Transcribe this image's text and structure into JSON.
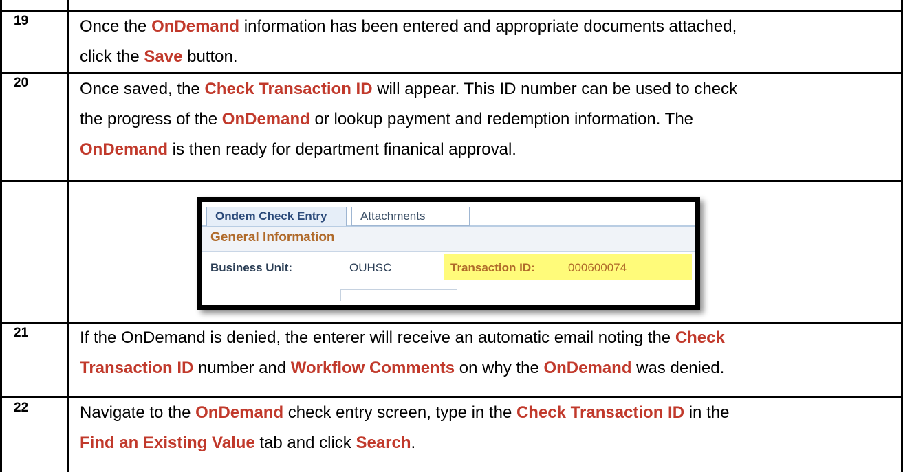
{
  "steps": [
    {
      "number": "19",
      "lines": [
        [
          {
            "t": "Once the ",
            "b": false
          },
          {
            "t": "OnDemand",
            "b": true
          },
          {
            "t": " information has been entered and appropriate documents attached,",
            "b": false
          }
        ],
        [
          {
            "t": "click the ",
            "b": false
          },
          {
            "t": "Save",
            "b": true
          },
          {
            "t": " button.",
            "b": false
          }
        ]
      ]
    },
    {
      "number": "20",
      "lines": [
        [
          {
            "t": "Once saved, the ",
            "b": false
          },
          {
            "t": "Check Transaction ID",
            "b": true
          },
          {
            "t": " will appear.  This ID number can be used to check",
            "b": false
          }
        ],
        [
          {
            "t": "the progress of the ",
            "b": false
          },
          {
            "t": "OnDemand",
            "b": true
          },
          {
            "t": " or lookup payment and redemption information.   The",
            "b": false
          }
        ],
        [
          {
            "t": "OnDemand",
            "b": true
          },
          {
            "t": " is then ready for department finanical approval.",
            "b": false
          }
        ]
      ]
    },
    {
      "number": "21",
      "lines": [
        [
          {
            "t": "If the OnDemand is denied, the enterer will receive an automatic email noting the ",
            "b": false
          },
          {
            "t": "Check",
            "b": true
          }
        ],
        [
          {
            "t": "Transaction ID",
            "b": true
          },
          {
            "t": " number and ",
            "b": false
          },
          {
            "t": "Workflow Comments",
            "b": true
          },
          {
            "t": " on why the ",
            "b": false
          },
          {
            "t": "OnDemand",
            "b": true
          },
          {
            "t": " was denied.",
            "b": false
          }
        ]
      ]
    },
    {
      "number": "22",
      "lines": [
        [
          {
            "t": "Navigate to the ",
            "b": false
          },
          {
            "t": "OnDemand",
            "b": true
          },
          {
            "t": " check entry screen, type in the ",
            "b": false
          },
          {
            "t": "Check Transaction ID",
            "b": true
          },
          {
            "t": " in the",
            "b": false
          }
        ],
        [
          {
            "t": "Find an Existing Value",
            "b": true
          },
          {
            "t": " tab and click ",
            "b": false
          },
          {
            "t": "Search",
            "b": true
          },
          {
            "t": ".",
            "b": false
          }
        ]
      ]
    }
  ],
  "screenshot": {
    "tabs": [
      "Ondem Check Entry",
      "Attachments"
    ],
    "section_title": "General Information",
    "business_unit_label": "Business Unit:",
    "business_unit_value": "OUHSC",
    "transaction_id_label": "Transaction ID:",
    "transaction_id_value": "000600074",
    "highlight_color": "#fffb7a"
  },
  "colors": {
    "emphasis": "#c1392b",
    "rule": "#000000"
  }
}
